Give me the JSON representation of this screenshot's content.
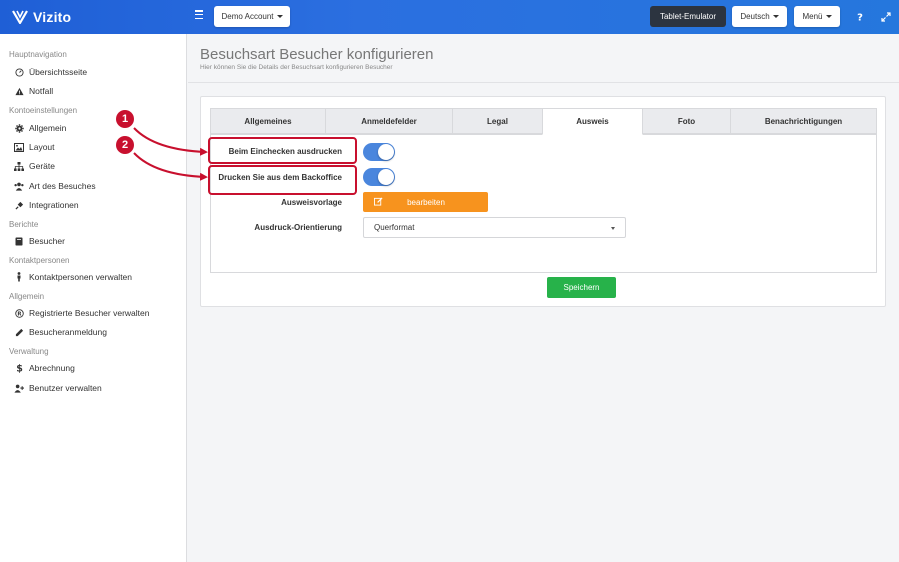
{
  "header": {
    "brand": "Vizito",
    "account_button": "Demo Account",
    "tablet_emulator": "Tablet-Emulator",
    "language_button": "Deutsch",
    "menu_button": "Menü",
    "help_icon": "question-icon",
    "fullscreen_icon": "expand-icon"
  },
  "sidebar": {
    "sections": [
      {
        "title": "Hauptnavigation",
        "items": [
          {
            "label": "Übersichtsseite",
            "icon": "gauge-icon"
          },
          {
            "label": "Notfall",
            "icon": "warning-icon"
          }
        ]
      },
      {
        "title": "Kontoeinstellungen",
        "items": [
          {
            "label": "Allgemein",
            "icon": "gear-icon"
          },
          {
            "label": "Layout",
            "icon": "image-icon"
          },
          {
            "label": "Geräte",
            "icon": "sitemap-icon"
          },
          {
            "label": "Art des Besuches",
            "icon": "users-icon"
          },
          {
            "label": "Integrationen",
            "icon": "plug-icon"
          }
        ]
      },
      {
        "title": "Berichte",
        "items": [
          {
            "label": "Besucher",
            "icon": "book-icon"
          }
        ]
      },
      {
        "title": "Kontaktpersonen",
        "items": [
          {
            "label": "Kontaktpersonen verwalten",
            "icon": "person-icon"
          }
        ]
      },
      {
        "title": "Allgemein",
        "items": [
          {
            "label": "Registrierte Besucher verwalten",
            "icon": "registered-icon"
          },
          {
            "label": "Besucheranmeldung",
            "icon": "pencil-icon"
          }
        ]
      },
      {
        "title": "Verwaltung",
        "items": [
          {
            "label": "Abrechnung",
            "icon": "dollar-icon"
          },
          {
            "label": "Benutzer verwalten",
            "icon": "user-plus-icon"
          }
        ]
      }
    ]
  },
  "page": {
    "title": "Besuchsart Besucher konfigurieren",
    "subtitle": "Hier können Sie die Details der Besuchsart konfigurieren Besucher"
  },
  "tabs": [
    {
      "label": "Allgemeines",
      "active": false
    },
    {
      "label": "Anmeldefelder",
      "active": false
    },
    {
      "label": "Legal",
      "active": false
    },
    {
      "label": "Ausweis",
      "active": true
    },
    {
      "label": "Foto",
      "active": false
    },
    {
      "label": "Benachrichtigungen",
      "active": false
    }
  ],
  "form": {
    "print_on_checkin_label": "Beim Einchecken ausdrucken",
    "print_on_checkin_value": true,
    "print_from_backoffice_label": "Drucken Sie aus dem Backoffice",
    "print_from_backoffice_value": true,
    "badge_template_label": "Ausweisvorlage",
    "edit_button": "bearbeiten",
    "orientation_label": "Ausdruck-Orientierung",
    "orientation_value": "Querformat",
    "save_button": "Speichern"
  },
  "annotations": [
    {
      "number": "1"
    },
    {
      "number": "2"
    }
  ],
  "colors": {
    "header_blue": "#2b6fe0",
    "toggle_blue": "#4a86dd",
    "orange": "#f7931e",
    "green": "#27b24a",
    "annotation_red": "#c8102e"
  }
}
